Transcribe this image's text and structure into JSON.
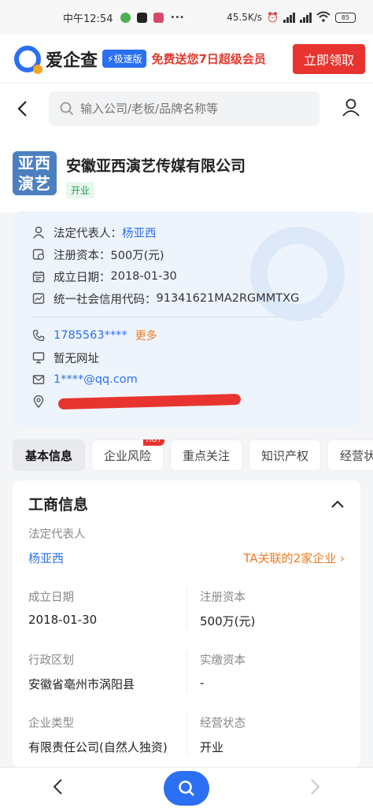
{
  "status_bar": {
    "time": "中午12:54",
    "net_speed": "45.5K/s",
    "battery": "85"
  },
  "banner": {
    "brand": "爱企查",
    "speed_badge": "极速版",
    "promo": "免费送您7日超级会员",
    "claim_button": "立即领取"
  },
  "search": {
    "placeholder": "输入公司/老板/品牌名称等"
  },
  "company": {
    "logo_text_1": "亚西",
    "logo_text_2": "演艺",
    "name": "安徽亚西演艺传媒有限公司",
    "status": "开业"
  },
  "info": {
    "legal_rep_label": "法定代表人：",
    "legal_rep": "杨亚西",
    "capital_label": "注册资本：",
    "capital": "500万(元)",
    "founded_label": "成立日期：",
    "founded": "2018-01-30",
    "credit_code_label": "统一社会信用代码：",
    "credit_code": "91341621MA2RGMMTXG",
    "phone": "1785563****",
    "phone_more": "更多",
    "website": "暂无网址",
    "email": "1****@qq.com"
  },
  "tabs": [
    {
      "label": "基本信息"
    },
    {
      "label": "企业风险",
      "badge": "HOT"
    },
    {
      "label": "重点关注"
    },
    {
      "label": "知识产权"
    },
    {
      "label": "经营状况"
    }
  ],
  "business": {
    "title": "工商信息",
    "legal_rep_label": "法定代表人",
    "legal_rep": "杨亚西",
    "related": "TA关联的2家企业",
    "founded_label": "成立日期",
    "founded": "2018-01-30",
    "capital_label": "注册资本",
    "capital": "500万(元)",
    "region_label": "行政区划",
    "region": "安徽省亳州市涡阳县",
    "paidin_label": "实缴资本",
    "paidin": "-",
    "type_label": "企业类型",
    "type": "有限责任公司(自然人独资)",
    "status_label": "经营状态",
    "status": "开业"
  },
  "colors": {
    "accent": "#2b6ff2",
    "red": "#e8342e",
    "orange": "#f07a1e",
    "green": "#1e9e55"
  }
}
